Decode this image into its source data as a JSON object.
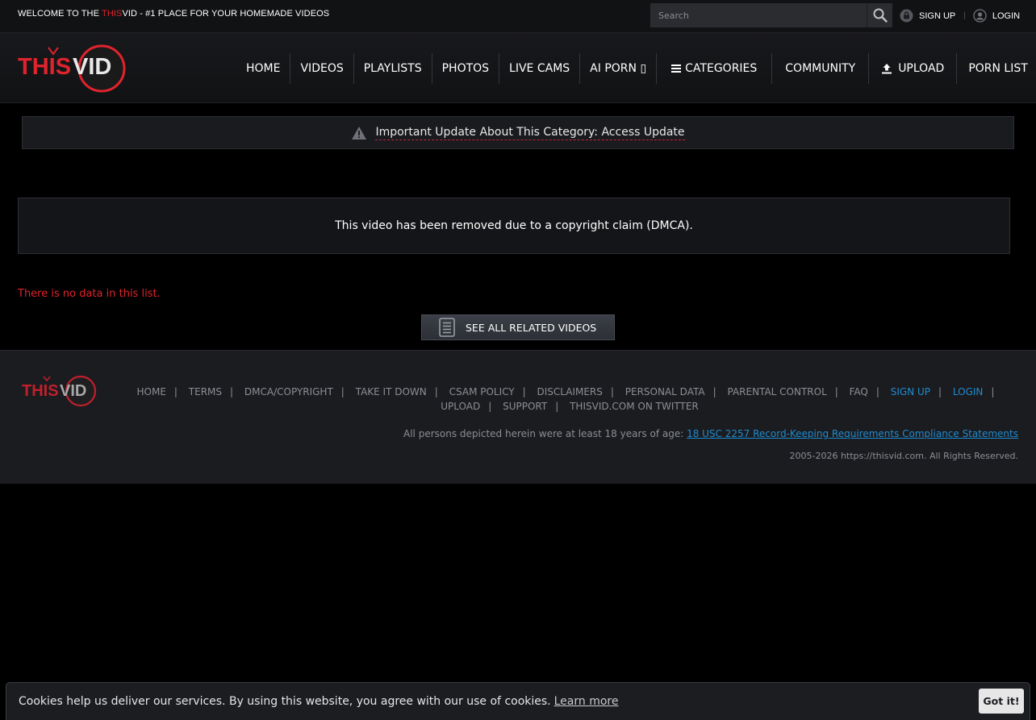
{
  "topbar": {
    "welcome_prefix": "WELCOME TO THE ",
    "welcome_highlight": "THIS",
    "welcome_suffix": "VID - #1 PLACE FOR YOUR HOMEMADE VIDEOS",
    "search_placeholder": "Search",
    "signup": "SIGN UP",
    "login": "LOGIN"
  },
  "logo": {
    "text_this": "THIS",
    "text_vid": "VID"
  },
  "nav": {
    "items": [
      "HOME",
      "VIDEOS",
      "PLAYLISTS",
      "PHOTOS",
      "LIVE CAMS",
      "AI PORN ▯",
      "CATEGORIES",
      "COMMUNITY",
      "UPLOAD",
      "PORN LIST"
    ]
  },
  "notice": {
    "text": "Important Update About This Category: Access Update"
  },
  "main": {
    "removed_message": "This video has been removed due to a copyright claim (DMCA).",
    "no_data": "There is no data in this list.",
    "related_button": "SEE ALL RELATED VIDEOS"
  },
  "footer": {
    "links": [
      {
        "label": "HOME",
        "blue": false
      },
      {
        "label": "TERMS",
        "blue": false
      },
      {
        "label": "DMCA/COPYRIGHT",
        "blue": false
      },
      {
        "label": "TAKE IT DOWN",
        "blue": false
      },
      {
        "label": "CSAM POLICY",
        "blue": false
      },
      {
        "label": "DISCLAIMERS",
        "blue": false
      },
      {
        "label": "PERSONAL DATA",
        "blue": false
      },
      {
        "label": "PARENTAL CONTROL",
        "blue": false
      },
      {
        "label": "FAQ",
        "blue": false
      },
      {
        "label": "SIGN UP",
        "blue": true
      },
      {
        "label": "LOGIN",
        "blue": true
      },
      {
        "label": "UPLOAD",
        "blue": false
      },
      {
        "label": "SUPPORT",
        "blue": false
      },
      {
        "label": "THISVID.COM ON TWITTER",
        "blue": false
      }
    ],
    "age_statement": "All persons depicted herein were at least 18 years of age: ",
    "compliance_link": "18 USC 2257 Record-Keeping Requirements Compliance Statements",
    "copyright": "2005-2026 https://thisvid.com. All Rights Reserved."
  },
  "cookie": {
    "text": "Cookies help us deliver our services. By using this website, you agree with our use of cookies.",
    "learn_more": "Learn more",
    "button": "Got it!"
  },
  "colors": {
    "accent_red": "#e0232d",
    "link_blue": "#1f8cd0",
    "background": "#000000"
  }
}
